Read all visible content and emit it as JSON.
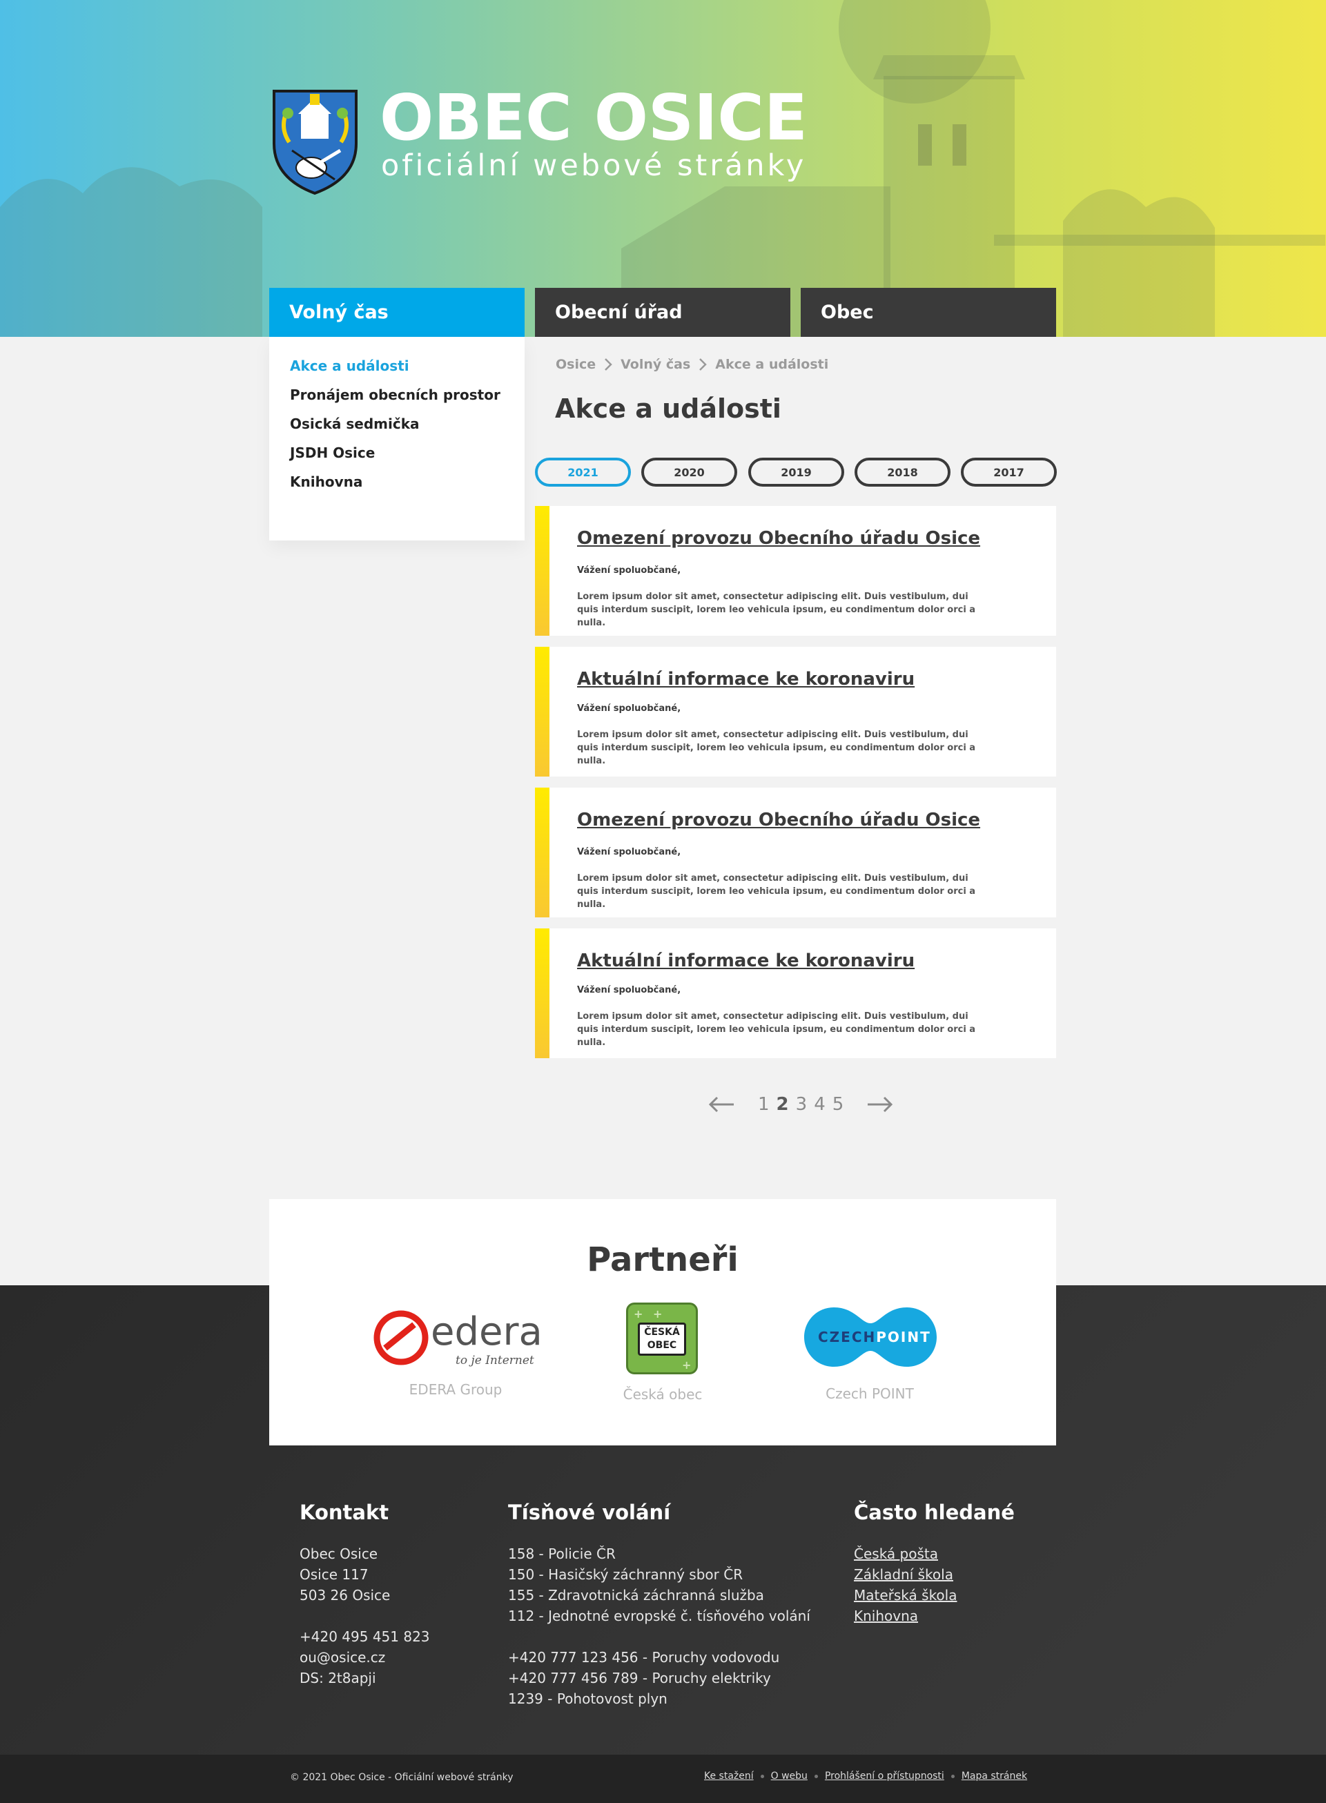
{
  "header": {
    "title": "OBEC OSICE",
    "subtitle": "oficiální webové stránky",
    "crest_icon": "coat-of-arms-icon"
  },
  "nav": {
    "tabs": [
      {
        "label": "Volný čas",
        "active": true
      },
      {
        "label": "Obecní úřad",
        "active": false
      },
      {
        "label": "Obec",
        "active": false
      }
    ]
  },
  "sidebar": {
    "items": [
      {
        "label": "Akce a události",
        "active": true
      },
      {
        "label": "Pronájem obecních prostor"
      },
      {
        "label": "Osická sedmička"
      },
      {
        "label": "JSDH Osice"
      },
      {
        "label": "Knihovna"
      }
    ]
  },
  "breadcrumb": [
    "Osice",
    "Volný čas",
    "Akce a události"
  ],
  "page_title": "Akce a události",
  "years": [
    {
      "label": "2021",
      "active": true
    },
    {
      "label": "2020"
    },
    {
      "label": "2019"
    },
    {
      "label": "2018"
    },
    {
      "label": "2017"
    }
  ],
  "articles": [
    {
      "title": "Omezení provozu Obecního úřadu Osice",
      "greeting": "Vážení spoluobčané,",
      "text": "Lorem ipsum dolor sit amet, consectetur adipiscing elit. Duis vestibulum, dui quis interdum suscipit, lorem leo vehicula ipsum, eu condimentum dolor orci a nulla."
    },
    {
      "title": "Aktuální informace ke koronaviru",
      "greeting": "Vážení spoluobčané,",
      "text": "Lorem ipsum dolor sit amet, consectetur adipiscing elit. Duis vestibulum, dui quis interdum suscipit, lorem leo vehicula ipsum, eu condimentum dolor orci a nulla."
    },
    {
      "title": "Omezení provozu Obecního úřadu Osice",
      "greeting": "Vážení spoluobčané,",
      "text": "Lorem ipsum dolor sit amet, consectetur adipiscing elit. Duis vestibulum, dui quis interdum suscipit, lorem leo vehicula ipsum, eu condimentum dolor orci a nulla."
    },
    {
      "title": "Aktuální informace ke koronaviru",
      "greeting": "Vážení spoluobčané,",
      "text": "Lorem ipsum dolor sit amet, consectetur adipiscing elit. Duis vestibulum, dui quis interdum suscipit, lorem leo vehicula ipsum, eu condimentum dolor orci a nulla."
    }
  ],
  "pagination": {
    "pages": [
      "1",
      "2",
      "3",
      "4",
      "5"
    ],
    "current": "2",
    "prev_icon": "arrow-left-icon",
    "next_icon": "arrow-right-icon"
  },
  "partners": {
    "title": "Partneři",
    "items": [
      {
        "name": "EDERA Group",
        "logo_word": "edera",
        "logo_tagline": "to je Internet"
      },
      {
        "name": "Česká obec",
        "logo_word_1": "ČESKÁ",
        "logo_word_2": "OBEC"
      },
      {
        "name": "Czech POINT",
        "logo_word_1": "CZECH",
        "logo_word_2": "POINT"
      }
    ]
  },
  "footer": {
    "contact": {
      "title": "Kontakt",
      "lines": [
        "Obec Osice",
        "Osice 117",
        "503 26 Osice",
        "",
        "+420 495 451 823",
        "ou@osice.cz",
        "DS: 2t8apji"
      ]
    },
    "emergency": {
      "title": "Tísňové volání",
      "lines": [
        "158 - Policie ČR",
        "150 - Hasičský záchranný sbor ČR",
        "155 - Zdravotnická záchranná služba",
        "112 - Jednotné evropské č. tísňového volání",
        "",
        "+420 777 123 456 - Poruchy vodovodu",
        "+420 777 456 789 - Poruchy elektriky",
        "1239 - Pohotovost plyn"
      ]
    },
    "frequent": {
      "title": "Často hledané",
      "links": [
        "Česká pošta",
        "Základní škola",
        "Mateřská škola",
        "Knihovna"
      ]
    },
    "copyright": "© 2021 Obec Osice - Oficiální webové stránky",
    "bottom_links": [
      "Ke stažení",
      "O webu",
      "Prohlášení o přístupnosti",
      "Mapa stránek"
    ]
  },
  "colors": {
    "accent": "#00a8e8",
    "dark": "#3a3a3a",
    "article_bar_top": "#ffeb00",
    "article_bar_bottom": "#f9c832"
  }
}
